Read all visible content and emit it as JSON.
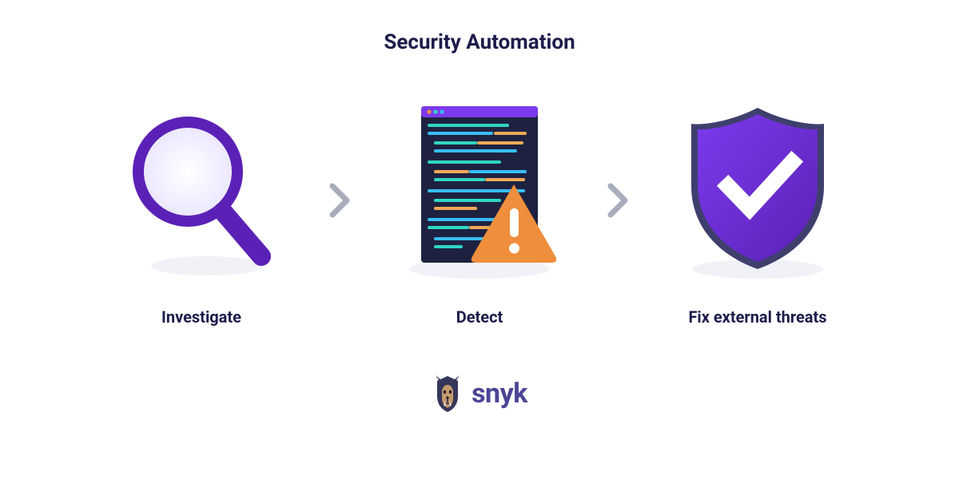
{
  "title": "Security Automation",
  "steps": [
    {
      "label": "Investigate",
      "icon": "magnifying-glass-icon"
    },
    {
      "label": "Detect",
      "icon": "code-warning-icon"
    },
    {
      "label": "Fix external threats",
      "icon": "shield-check-icon"
    }
  ],
  "brand": {
    "name": "snyk",
    "icon": "snyk-dog-icon"
  },
  "colors": {
    "dark_navy": "#1c1c4b",
    "purple": "#5b21b6",
    "purple_mid": "#6d28d9",
    "lavender": "#e9e5ff",
    "orange": "#ef8e3c",
    "gray_chevron": "#a7adbb",
    "code_bg": "#1e2240",
    "teal": "#2fd6c4",
    "cyan": "#38bdf8",
    "amber_line": "#f0a857"
  }
}
